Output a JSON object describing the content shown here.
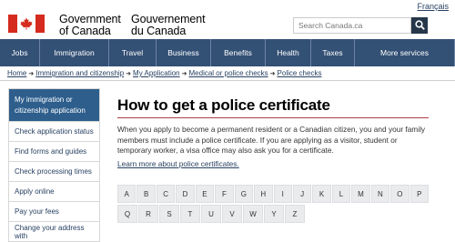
{
  "header": {
    "gov_en_line1": "Government",
    "gov_en_line2": "of Canada",
    "gov_fr_line1": "Gouvernement",
    "gov_fr_line2": "du Canada",
    "language_link": "Français",
    "search_placeholder": "Search Canada.ca"
  },
  "menu": [
    {
      "label": "Jobs",
      "width": 44
    },
    {
      "label": "Immigration",
      "width": 76
    },
    {
      "label": "Travel",
      "width": 52
    },
    {
      "label": "Business",
      "width": 60
    },
    {
      "label": "Benefits",
      "width": 60
    },
    {
      "label": "Health",
      "width": 50
    },
    {
      "label": "Taxes",
      "width": 48
    },
    {
      "label": "More services",
      "width": 110
    }
  ],
  "breadcrumb": [
    "Home",
    "Immigration and citizenship",
    "My Application",
    "Medical or police checks",
    "Police checks"
  ],
  "sidebar": {
    "active_line1": "My immigration or",
    "active_line2": "citizenship application",
    "items": [
      "Check application status",
      "Find forms and guides",
      "Check processing times",
      "Apply online",
      "Pay your fees",
      "Change your address with"
    ]
  },
  "main": {
    "title": "How to get a police certificate",
    "intro": "When you apply to become a permanent resident or a Canadian citizen, you and your family members must include a police certificate. If you are applying as a visitor, student or temporary worker, a visa office may also ask you for a certificate.",
    "learn_more": "Learn more about police certificates.",
    "letters_row1": [
      "A",
      "B",
      "C",
      "D",
      "E",
      "F",
      "G",
      "H",
      "I",
      "J",
      "K",
      "L",
      "M",
      "N",
      "O",
      "P"
    ],
    "letters_row2": [
      "Q",
      "R",
      "S",
      "T",
      "U",
      "V",
      "W",
      "Y",
      "Z"
    ]
  },
  "colors": {
    "menu_bg": "#335075",
    "sidebar_active": "#2e5e8c",
    "flag_red": "#d52b1e",
    "title_rule": "#af3c43"
  }
}
